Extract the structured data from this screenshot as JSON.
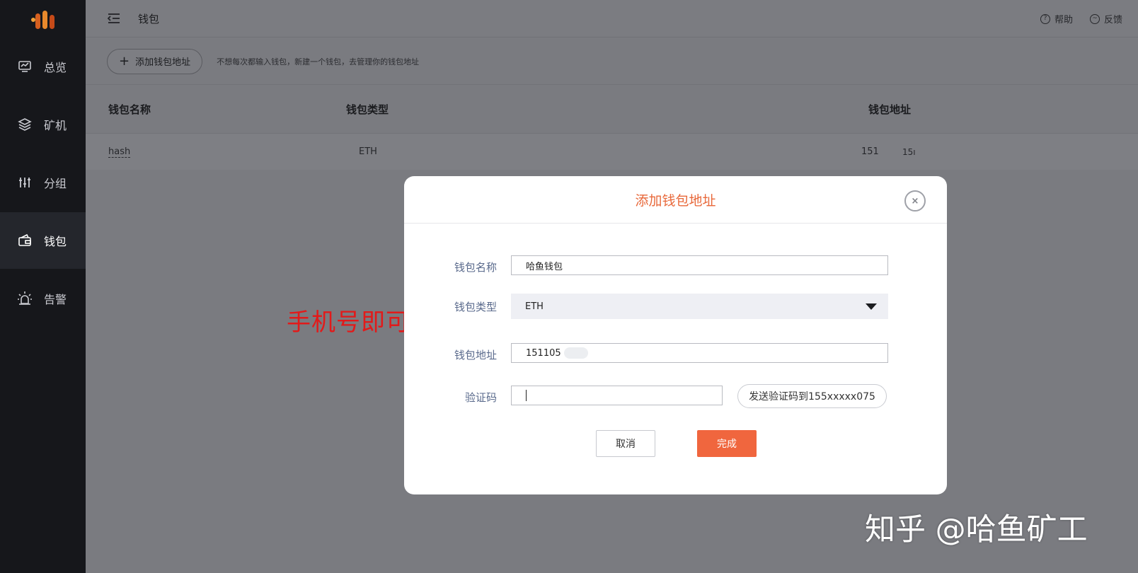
{
  "sidebar": {
    "items": [
      {
        "label": "总览",
        "icon": "monitor-chart-icon"
      },
      {
        "label": "矿机",
        "icon": "layers-icon"
      },
      {
        "label": "分组",
        "icon": "sliders-icon"
      },
      {
        "label": "钱包",
        "icon": "wallet-icon",
        "active": true
      },
      {
        "label": "告警",
        "icon": "alarm-icon"
      }
    ]
  },
  "header": {
    "title": "钱包",
    "help_label": "帮助",
    "feedback_label": "反馈"
  },
  "toolbar": {
    "add_button_label": "添加钱包地址",
    "hint": "不想每次都输入钱包，新建一个钱包，去管理你的钱包地址"
  },
  "table": {
    "columns": [
      "钱包名称",
      "钱包类型",
      "钱包地址"
    ],
    "rows": [
      {
        "name": "hash",
        "type": "ETH",
        "address": "151",
        "extra": "15ı"
      }
    ]
  },
  "modal": {
    "title": "添加钱包地址",
    "close_symbol": "×",
    "fields": {
      "name_label": "钱包名称",
      "name_value": "哈鱼钱包",
      "type_label": "钱包类型",
      "type_value": "ETH",
      "address_label": "钱包地址",
      "address_value": "151105",
      "code_label": "验证码",
      "code_value": ""
    },
    "send_code_label": "发送验证码到155xxxxx075",
    "cancel_label": "取消",
    "done_label": "完成"
  },
  "annotation": {
    "text": "手机号即可",
    "color": "#e21a1a"
  },
  "watermark": "知乎 @哈鱼矿工",
  "colors": {
    "accent": "#f0663e",
    "modal_title": "#e8683a",
    "sidebar_bg": "#16171b"
  }
}
